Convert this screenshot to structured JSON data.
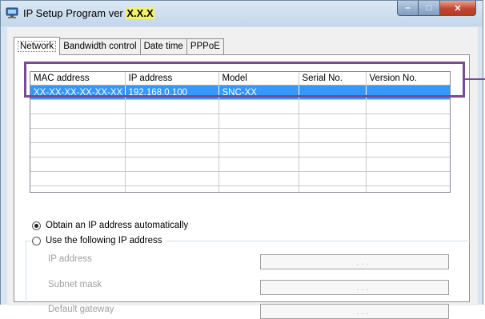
{
  "window": {
    "title_prefix": "IP Setup Program ver ",
    "title_version": "X.X.X",
    "controls": {
      "minimize": "–",
      "maximize": "□",
      "close": "✕"
    }
  },
  "tabs": [
    {
      "label": "Network",
      "active": true
    },
    {
      "label": "Bandwidth control",
      "active": false
    },
    {
      "label": "Date time",
      "active": false
    },
    {
      "label": "PPPoE",
      "active": false
    }
  ],
  "device_table": {
    "columns": [
      "MAC address",
      "IP address",
      "Model",
      "Serial No.",
      "Version No."
    ],
    "rows": [
      [
        "XX-XX-XX-XX-XX-XX",
        "192.168.0.100",
        "SNC-XX",
        "",
        ""
      ]
    ]
  },
  "ip_settings": {
    "obtain_auto_label": "Obtain an IP address automatically",
    "obtain_auto_selected": true,
    "use_following_label": "Use the following IP address",
    "use_following_selected": false,
    "fields": [
      {
        "label": "IP address",
        "value": ".   .   ."
      },
      {
        "label": "Subnet mask",
        "value": ".   .   ."
      },
      {
        "label": "Default gateway",
        "value": ".   .   ."
      }
    ]
  },
  "colors": {
    "selection": "#3399ff",
    "highlight_frame": "#7a4a95",
    "title_version_bg": "#f3f06a"
  },
  "icons": {
    "app": "network-monitor-icon",
    "minimize": "minimize-icon",
    "maximize": "maximize-icon",
    "close": "close-icon"
  }
}
